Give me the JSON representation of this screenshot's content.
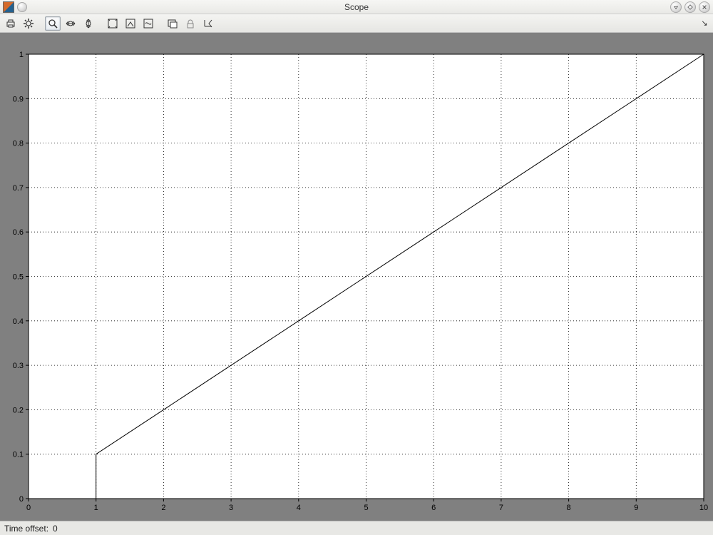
{
  "window": {
    "title": "Scope"
  },
  "toolbar": {
    "overflow_glyph": "↘"
  },
  "status": {
    "label": "Time offset:",
    "value": "0"
  },
  "chart_data": {
    "type": "line",
    "title": "",
    "xlabel": "",
    "ylabel": "",
    "xlim": [
      0,
      10
    ],
    "ylim": [
      0,
      1
    ],
    "xticks": [
      0,
      1,
      2,
      3,
      4,
      5,
      6,
      7,
      8,
      9,
      10
    ],
    "yticks": [
      0,
      0.1,
      0.2,
      0.3,
      0.4,
      0.5,
      0.6,
      0.7,
      0.8,
      0.9,
      1
    ],
    "x": [
      0,
      1,
      1,
      2,
      3,
      4,
      5,
      6,
      7,
      8,
      9,
      10
    ],
    "values": [
      0,
      0,
      0.1,
      0.2,
      0.3,
      0.4,
      0.5,
      0.6,
      0.7,
      0.8,
      0.9,
      1.0
    ],
    "grid": true
  }
}
